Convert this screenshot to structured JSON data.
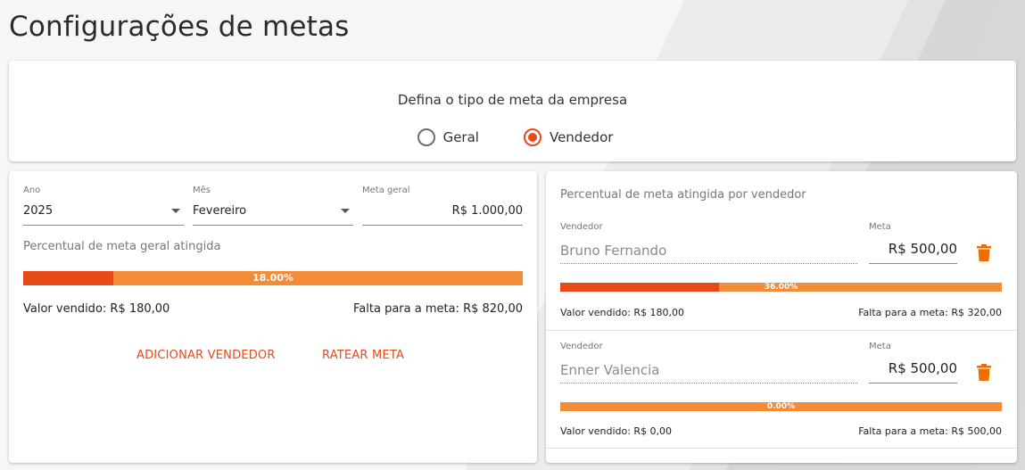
{
  "page": {
    "title": "Configurações de metas"
  },
  "goal_type": {
    "title": "Defina o tipo de meta da empresa",
    "options": [
      {
        "label": "Geral",
        "selected": false
      },
      {
        "label": "Vendedor",
        "selected": true
      }
    ]
  },
  "general": {
    "year": {
      "label": "Ano",
      "value": "2025"
    },
    "month": {
      "label": "Mês",
      "value": "Fevereiro"
    },
    "goal": {
      "label": "Meta geral",
      "value": "R$ 1.000,00"
    },
    "progress_title": "Percentual de meta geral atingida",
    "progress": {
      "percent": 18,
      "label": "18.00%"
    },
    "sold": "Valor vendido: R$ 180,00",
    "remaining": "Falta para a meta: R$ 820,00",
    "add_seller_label": "ADICIONAR VENDEDOR",
    "split_goal_label": "RATEAR META"
  },
  "per_seller": {
    "title": "Percentual de meta atingida por vendedor",
    "sellers": [
      {
        "seller_label": "Vendedor",
        "name": "Bruno Fernando",
        "meta_label": "Meta",
        "meta_value": "R$ 500,00",
        "progress": {
          "percent": 36,
          "label": "36.00%"
        },
        "sold": "Valor vendido: R$ 180,00",
        "remaining": "Falta para a meta: R$ 320,00"
      },
      {
        "seller_label": "Vendedor",
        "name": "Enner Valencia",
        "meta_label": "Meta",
        "meta_value": "R$ 500,00",
        "progress": {
          "percent": 0,
          "label": "0.00%"
        },
        "sold": "Valor vendido: R$ 0,00",
        "remaining": "Falta para a meta: R$ 500,00"
      }
    ]
  },
  "colors": {
    "accent": "#e64a19",
    "bar_bg": "#f28c38",
    "trash": "#ef6c00"
  },
  "icons": {
    "delete": "trash-icon",
    "dropdown": "chevron-down-icon"
  }
}
